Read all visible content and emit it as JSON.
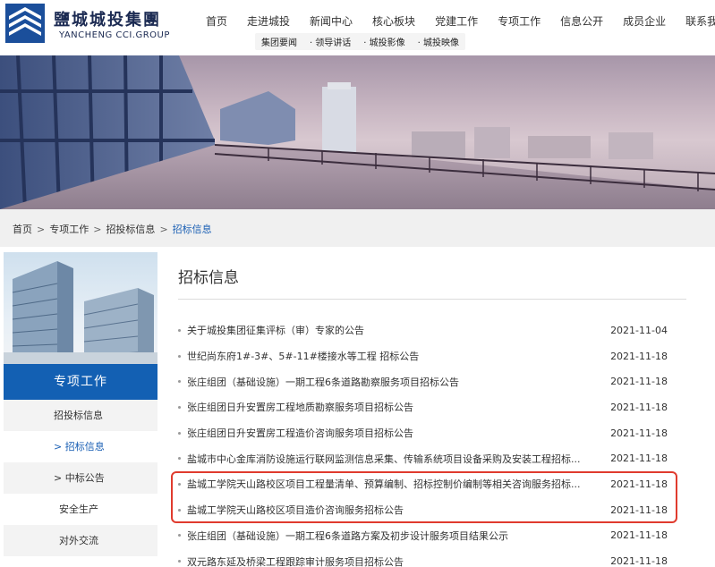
{
  "header": {
    "logo_cn": "鹽城城投集團",
    "logo_en": "YANCHENG CCI.GROUP",
    "nav": [
      "首页",
      "走进城投",
      "新闻中心",
      "核心板块",
      "党建工作",
      "专项工作",
      "信息公开",
      "成员企业",
      "联系我们"
    ],
    "subnav": [
      "集团要闻",
      "· 领导讲话",
      "· 城投影像",
      "· 城投映像"
    ]
  },
  "breadcrumb": {
    "items": [
      "首页",
      "专项工作",
      "招投标信息"
    ],
    "separator": ">",
    "current": "招标信息"
  },
  "sidebar": {
    "title": "专项工作",
    "items": [
      "招投标信息",
      "> 招标信息",
      "> 中标公告",
      "安全生产",
      "对外交流"
    ]
  },
  "main": {
    "title": "招标信息",
    "rows": [
      {
        "title": "关于城投集团征集评标（审）专家的公告",
        "date": "2021-11-04"
      },
      {
        "title": "世纪尚东府1#-3#、5#-11#楼接水等工程 招标公告",
        "date": "2021-11-18"
      },
      {
        "title": "张庄组团（基础设施）一期工程6条道路勘察服务项目招标公告",
        "date": "2021-11-18"
      },
      {
        "title": "张庄组团日升安置房工程地质勘察服务项目招标公告",
        "date": "2021-11-18"
      },
      {
        "title": "张庄组团日升安置房工程造价咨询服务项目招标公告",
        "date": "2021-11-18"
      },
      {
        "title": "盐城市中心金库消防设施运行联网监测信息采集、传输系统项目设备采购及安装工程招标...",
        "date": "2021-11-18"
      },
      {
        "title": "盐城工学院天山路校区项目工程量清单、预算编制、招标控制价编制等相关咨询服务招标...",
        "date": "2021-11-18"
      },
      {
        "title": "盐城工学院天山路校区项目造价咨询服务招标公告",
        "date": "2021-11-18"
      },
      {
        "title": "张庄组团（基础设施）一期工程6条道路方案及初步设计服务项目结果公示",
        "date": "2021-11-18"
      },
      {
        "title": "双元路东延及桥梁工程跟踪审计服务项目招标公告",
        "date": "2021-11-18"
      }
    ]
  },
  "colors": {
    "brand_blue": "#1360b3",
    "link_blue": "#1a5fb4",
    "highlight_red": "#e03b2e"
  }
}
